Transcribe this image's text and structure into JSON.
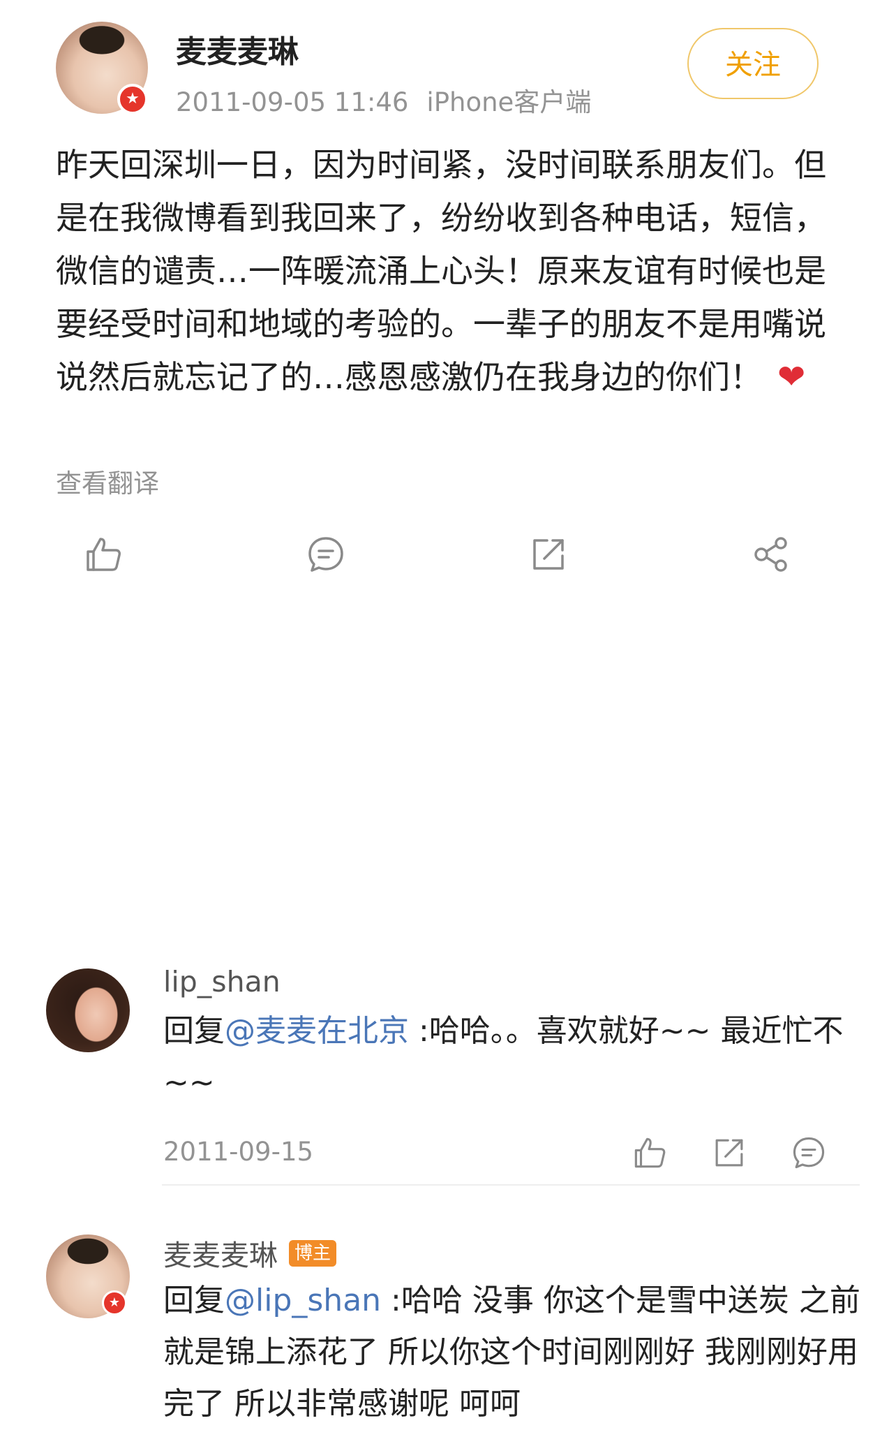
{
  "post": {
    "author": "麦麦麦琳",
    "timestamp": "2011-09-05 11:46",
    "source": "iPhone客户端",
    "follow_label": "关注",
    "text": "昨天回深圳一日，因为时间紧，没时间联系朋友们。但是在我微博看到我回来了，纷纷收到各种电话，短信，微信的谴责…一阵暖流涌上心头！原来友谊有时候也是要经受时间和地域的考验的。一辈子的朋友不是用嘴说说然后就忘记了的…感恩感激仍在我身边的你们！",
    "emoji": "❤",
    "translate_label": "查看翻译",
    "actions": [
      "like-icon",
      "comment-icon",
      "repost-icon",
      "share-icon"
    ]
  },
  "comments": [
    {
      "name": "lip_shan",
      "reply_prefix": "回复",
      "mention": "@麦麦在北京",
      "text": " :哈哈。。喜欢就好~~ 最近忙不~~",
      "date": "2011-09-15",
      "actions": [
        "like-icon",
        "repost-icon",
        "comment-icon"
      ]
    },
    {
      "name": "麦麦麦琳",
      "badge": "博主",
      "reply_prefix": "回复",
      "mention": "@lip_shan",
      "text": " :哈哈 没事 你这个是雪中送炭 之前就是锦上添花了 所以你这个时间刚刚好 我刚刚好用完了 所以非常感谢呢 呵呵"
    }
  ],
  "colors": {
    "accent_orange": "#f0a000",
    "mention_blue": "#4a76b7",
    "verified_red": "#e5352b",
    "host_badge": "#f28c28",
    "muted_gray": "#939393"
  }
}
